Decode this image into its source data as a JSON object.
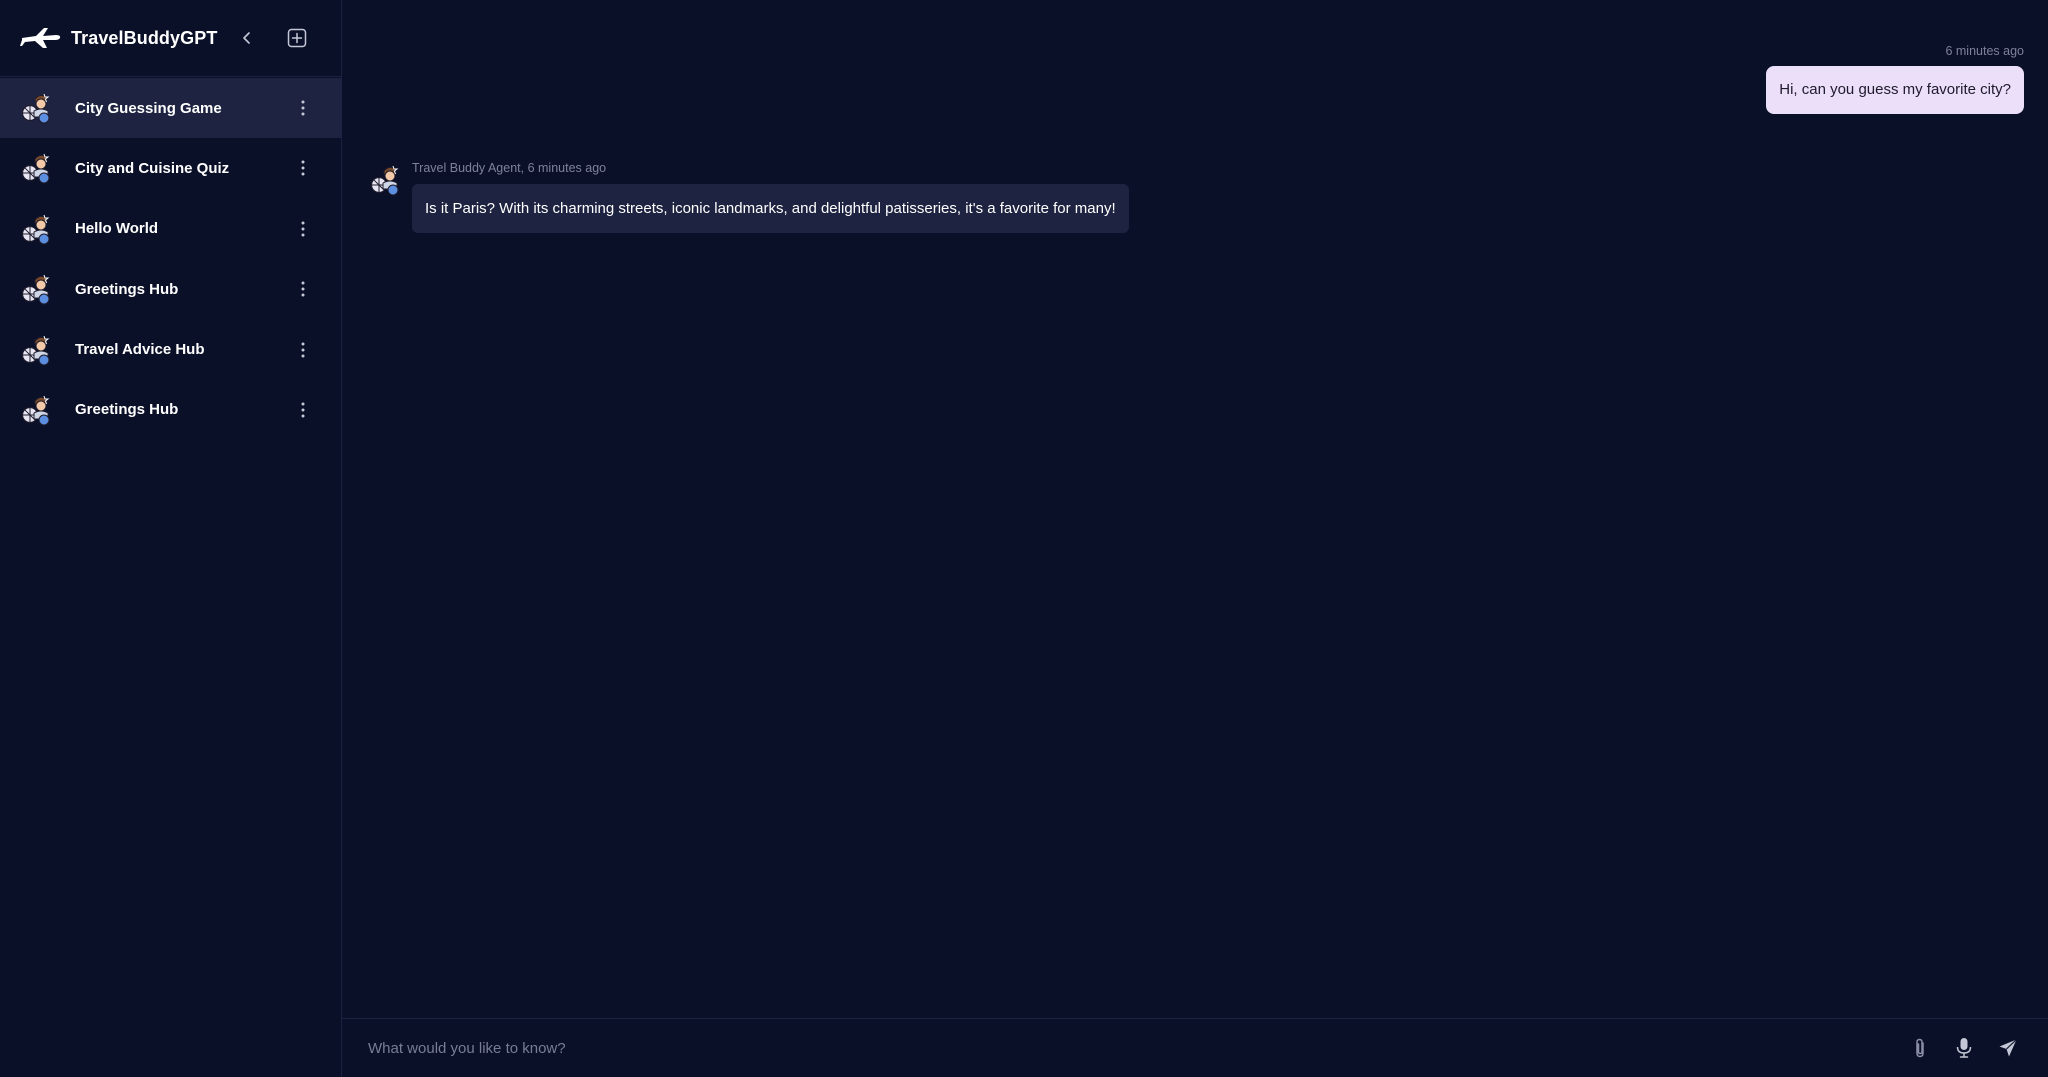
{
  "app": {
    "title": "TravelBuddyGPT"
  },
  "sidebar": {
    "conversations": [
      {
        "label": "City Guessing Game",
        "active": true
      },
      {
        "label": "City and Cuisine Quiz",
        "active": false
      },
      {
        "label": "Hello World",
        "active": false
      },
      {
        "label": "Greetings Hub",
        "active": false
      },
      {
        "label": "Travel Advice Hub",
        "active": false
      },
      {
        "label": "Greetings Hub",
        "active": false
      }
    ]
  },
  "chat": {
    "user_message": {
      "timestamp": "6 minutes ago",
      "text": "Hi, can you guess my favorite city?"
    },
    "bot_message": {
      "sender": "Travel Buddy Agent,",
      "timestamp": "6 minutes ago",
      "text": "Is it Paris? With its charming streets, iconic landmarks, and delightful patisseries, it's a favorite for many!"
    }
  },
  "input": {
    "placeholder": "What would you like to know?"
  },
  "colors": {
    "background": "#0b1029",
    "active_item": "#1d2340",
    "user_bubble": "#ecdff9",
    "bot_bubble": "#1d2340",
    "muted_text": "#7d8298"
  }
}
